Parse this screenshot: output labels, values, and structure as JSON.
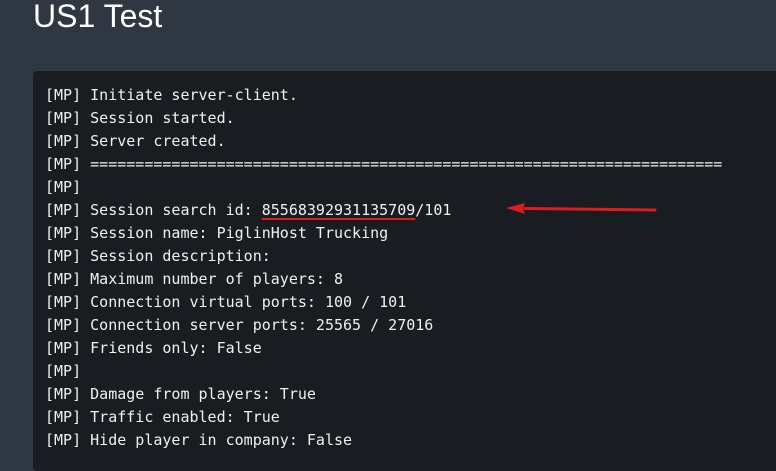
{
  "page": {
    "title": "US1 Test"
  },
  "console": {
    "lines": [
      "[MP] Initiate server-client.",
      "[MP] Session started.",
      "[MP] Server created.",
      "[MP] ======================================================================",
      "[MP]",
      {
        "prefix": "[MP] Session search id: ",
        "highlight": "85568392931135709",
        "suffix": "/101"
      },
      "[MP] Session name: PiglinHost Trucking",
      "[MP] Session description:",
      "[MP] Maximum number of players: 8",
      "[MP] Connection virtual ports: 100 / 101",
      "[MP] Connection server ports: 25565 / 27016",
      "[MP] Friends only: False",
      "[MP]",
      "[MP] Damage from players: True",
      "[MP] Traffic enabled: True",
      "[MP] Hide player in company: False"
    ]
  },
  "annotation": {
    "color": "#e01b1b"
  }
}
